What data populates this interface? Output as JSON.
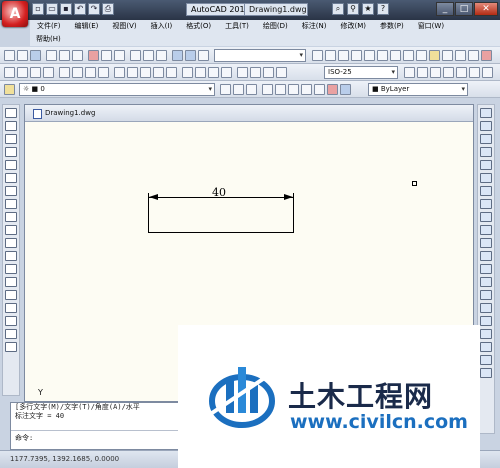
{
  "title_bar": {
    "app_name": "AutoCAD 2010",
    "document_name": "Drawing1.dwg"
  },
  "menu": {
    "row1": [
      "文件(F)",
      "编辑(E)",
      "视图(V)",
      "插入(I)",
      "格式(O)",
      "工具(T)",
      "绘图(D)",
      "标注(N)",
      "修改(M)",
      "参数(P)",
      "窗口(W)"
    ],
    "row2": [
      "帮助(H)"
    ]
  },
  "toolbar": {
    "dim_style": "ISO-25",
    "layer": "0",
    "color": "ByLayer"
  },
  "drawing": {
    "tab_label": "Drawing1.dwg",
    "dimension_value": "40",
    "axis_label": "Y"
  },
  "command": {
    "history_line1": "[多行文字(M)/文字(T)/角度(A)/水平",
    "history_line2": "标注文字 = 40",
    "prompt": "命令:"
  },
  "status": {
    "coordinates": "1177.7395, 1392.1685, 0.0000"
  },
  "watermark": {
    "brand": "土木工程网",
    "url": "www.civilcn.com"
  },
  "colors": {
    "canvas_bg": "#fdfcf3",
    "chrome": "#dfe6f0",
    "accent": "#1b6fbf"
  }
}
